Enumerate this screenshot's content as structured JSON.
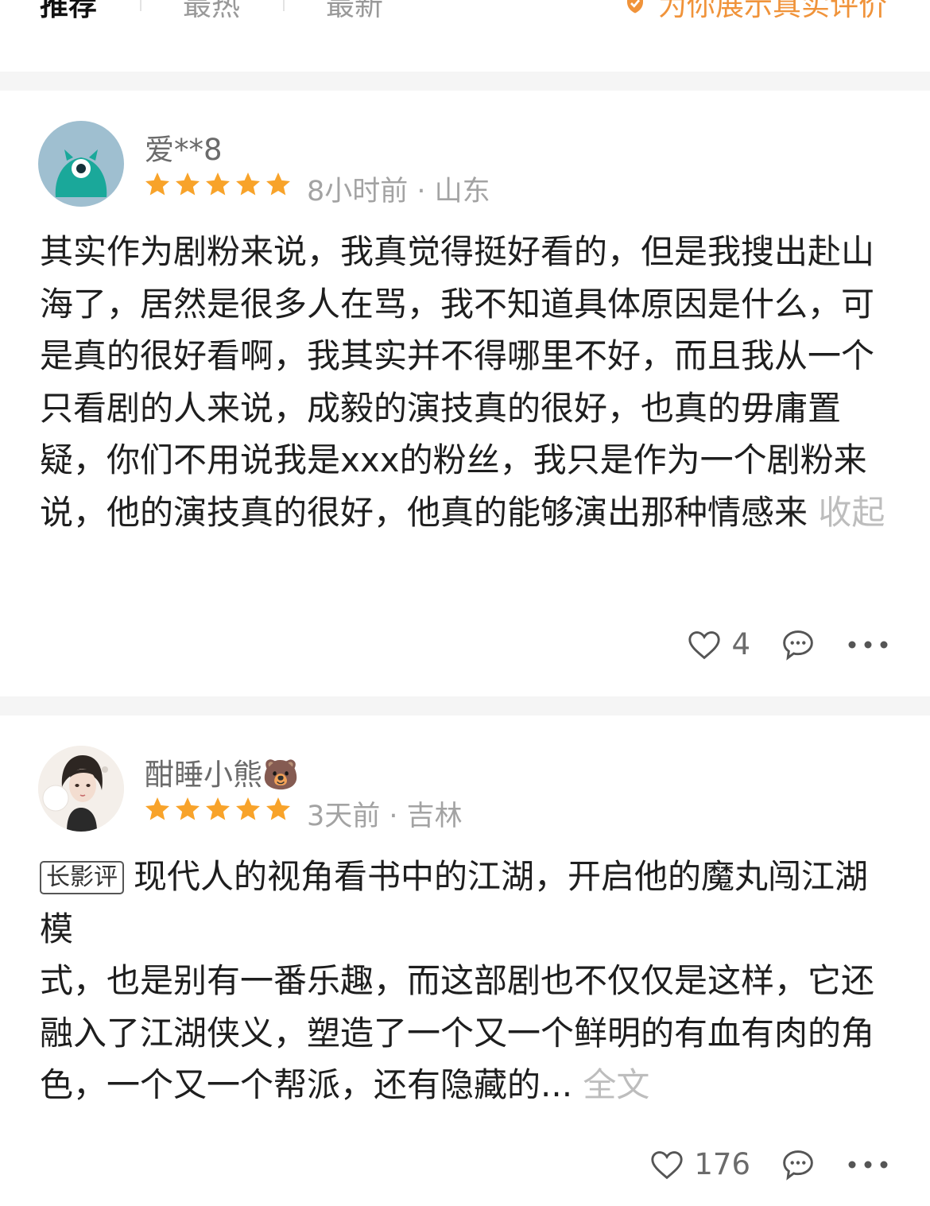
{
  "tabs": [
    {
      "label": "推荐"
    },
    {
      "label": "最热"
    },
    {
      "label": "最新"
    }
  ],
  "real_review_note": "为你展示真实评价",
  "colors": {
    "star": "#f8a32a",
    "accent": "#f0933a",
    "muted": "#a3a3a3"
  },
  "icons": {
    "star": "star-icon",
    "like": "heart-outline-icon",
    "comment": "speech-bubble-icon",
    "more": "more-dots-icon",
    "note": "verified-shield-icon"
  },
  "reviews": [
    {
      "username": "爱**8",
      "rating": 5,
      "time": "8小时前",
      "location": "山东",
      "meta": "8小时前 · 山东",
      "text": "其实作为剧粉来说，我真觉得挺好看的，但是我搜出赴山海了，居然是很多人在骂，我不知道具体原因是什么，可是真的很好看啊，我其实并不得哪里不好，而且我从一个只看剧的人来说，成毅的演技真的很好，也真的毋庸置疑，你们不用说我是xxx的粉丝，我只是作为一个剧粉来说，他的演技真的很好，他真的能够演出那种情感来",
      "more_label": "收起",
      "likes": "4"
    },
    {
      "username": "酣睡小熊🐻",
      "rating": 5,
      "time": "3天前",
      "location": "吉林",
      "meta": "3天前 · 吉林",
      "tag": "长影评",
      "text_line1": "现代人的视角看书中的江湖，开启他的魔丸闯江湖模",
      "text_rest": "式，也是别有一番乐趣，而这部剧也不仅仅是这样，它还融入了江湖侠义，塑造了一个又一个鲜明的有血有肉的角色，一个又一个帮派，还有隐藏的...",
      "more_label": "全文",
      "likes": "176"
    }
  ]
}
